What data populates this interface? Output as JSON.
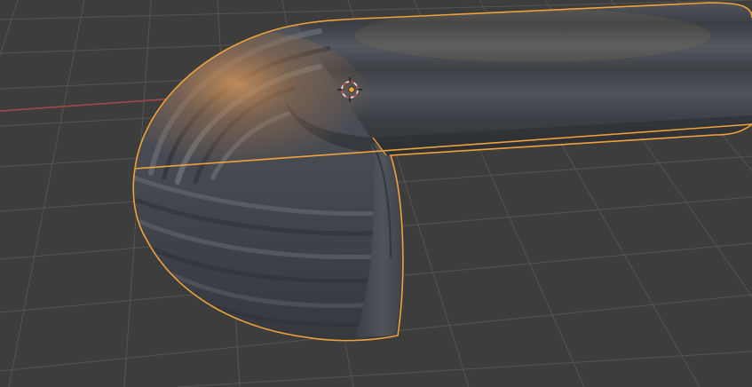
{
  "viewport": {
    "label": "3D Viewport",
    "shading": "solid",
    "background_color": "#3d3d3d",
    "grid_color": "#545454",
    "x_axis_color": "#a8474a"
  },
  "object": {
    "kind": "curved tube mesh",
    "selected": true,
    "selection_outline_color": "#f0a23a",
    "base_color": "#4a4e55",
    "highlight_color": "#c88a55"
  },
  "cursor": {
    "name": "3d-cursor",
    "ring_colors": [
      "#e9e9e9",
      "#d14b4b"
    ]
  },
  "origin": {
    "name": "object-origin",
    "color": "#f2a33a"
  }
}
